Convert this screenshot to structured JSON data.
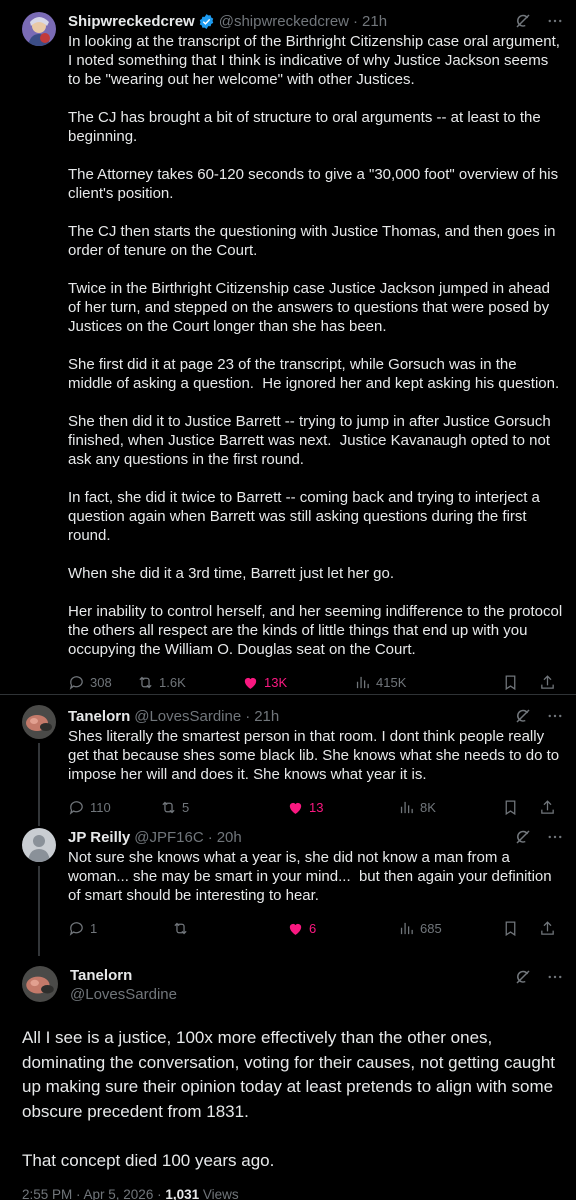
{
  "tweets": [
    {
      "name": "Shipwreckedcrew",
      "handle": "@shipwreckedcrew",
      "sep": "·",
      "time": "21h",
      "verified": true,
      "text": "In looking at the transcript of the Birthright Citizenship case oral argument, I noted something that I think is indicative of why Justice Jackson seems to be \"wearing out her welcome\" with other Justices.\n\nThe CJ has brought a bit of structure to oral arguments -- at least to the beginning.\n\nThe Attorney takes 60-120 seconds to give a \"30,000 foot\" overview of his client's position.\n\nThe CJ then starts the questioning with Justice Thomas, and then goes in order of tenure on the Court.\n\nTwice in the Birthright Citizenship case Justice Jackson jumped in ahead of her turn, and stepped on the answers to questions that were posed by Justices on the Court longer than she has been.\n\nShe first did it at page 23 of the transcript, while Gorsuch was in the middle of asking a question.  He ignored her and kept asking his question.\n\nShe then did it to Justice Barrett -- trying to jump in after Justice Gorsuch finished, when Justice Barrett was next.  Justice Kavanaugh opted to not ask any questions in the first round.\n\nIn fact, she did it twice to Barrett -- coming back and trying to interject a question again when Barrett was still asking questions during the first round.\n\nWhen she did it a 3rd time, Barrett just let her go.\n\nHer inability to control herself, and her seeming indifference to the protocol the others all respect are the kinds of little things that end up with you occupying the William O. Douglas seat on the Court.",
      "replies": "308",
      "reposts": "1.6K",
      "likes": "13K",
      "views": "415K"
    },
    {
      "name": "Tanelorn",
      "handle": "@LovesSardine",
      "sep": "·",
      "time": "21h",
      "verified": false,
      "text": "Shes literally the smartest person in that room. I dont think people really get that because shes some black lib. She knows what she needs to do to impose her will and does it. She knows what year it is.",
      "replies": "110",
      "reposts": "5",
      "likes": "13",
      "views": "8K"
    },
    {
      "name": "JP Reilly",
      "handle": "@JPF16C",
      "sep": "·",
      "time": "20h",
      "verified": false,
      "text": "Not sure she knows what a year is, she did not know a man from a woman... she may be smart in your mind...  but then again your definition of smart should be interesting to hear.",
      "replies": "1",
      "reposts": "",
      "likes": "6",
      "views": "685"
    }
  ],
  "main": {
    "name": "Tanelorn",
    "handle": "@LovesSardine",
    "text": "All I see is a justice, 100x more effectively than the other ones, dominating the conversation, voting for their causes, not getting caught up making sure their opinion today at least pretends to align with some obscure precedent from 1831.\n\nThat concept died 100 years ago.",
    "timestamp": "2:55 PM · Apr 5, 2026 · ",
    "views_count": "1,031",
    "views_label": " Views"
  },
  "colors": {
    "background": "#000000",
    "text": "#e7e9ea",
    "muted": "#71767b",
    "like": "#f91880",
    "verified": "#1d9bf0"
  },
  "icons": [
    "grok-icon",
    "more-icon",
    "reply-icon",
    "repost-icon",
    "like-icon",
    "views-icon",
    "bookmark-icon",
    "share-icon",
    "verified-icon"
  ]
}
